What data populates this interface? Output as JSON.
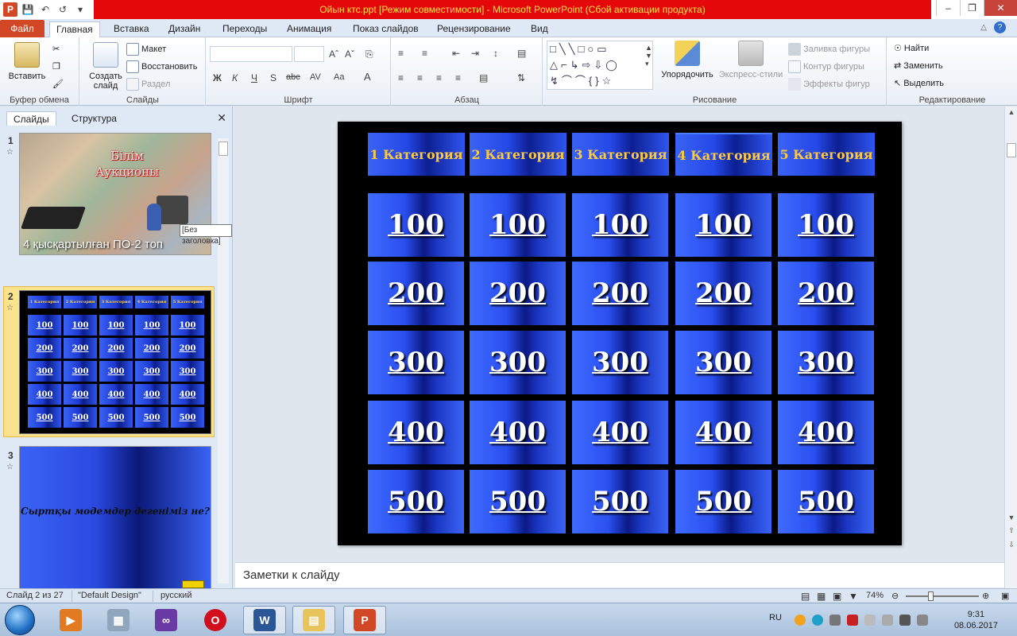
{
  "window": {
    "title": "Ойын ктс.ppt [Режим совместимости]  -  Microsoft PowerPoint (Сбой активации продукта)"
  },
  "tabs": {
    "file": "Файл",
    "items": [
      "Главная",
      "Вставка",
      "Дизайн",
      "Переходы",
      "Анимация",
      "Показ слайдов",
      "Рецензирование",
      "Вид"
    ]
  },
  "ribbon": {
    "clipboard": {
      "label": "Буфер обмена",
      "paste": "Вставить"
    },
    "slides": {
      "label": "Слайды",
      "new_slide": "Создать слайд",
      "layout": "Макет",
      "reset": "Восстановить",
      "section": "Раздел"
    },
    "font": {
      "label": "Шрифт"
    },
    "paragraph": {
      "label": "Абзац"
    },
    "drawing": {
      "label": "Рисование",
      "arrange": "Упорядочить",
      "quick_styles": "Экспресс-стили",
      "fill": "Заливка фигуры",
      "outline": "Контур фигуры",
      "effects": "Эффекты фигур"
    },
    "editing": {
      "label": "Редактирование",
      "find": "Найти",
      "replace": "Заменить",
      "select": "Выделить"
    }
  },
  "left_panel": {
    "tab_slides": "Слайды",
    "tab_outline": "Структура",
    "slide1": {
      "num": "1",
      "title_line1": "Білім",
      "title_line2": "Аукционы",
      "subtitle": "4 қысқартылған ПО-2 топ",
      "tooltip": "[Без заголовка]"
    },
    "slide2": {
      "num": "2"
    },
    "slide3": {
      "num": "3",
      "question": "Сыртқы модемдер дегеніміз не?"
    }
  },
  "slide": {
    "categories": [
      "1 Категория",
      "2 Категория",
      "3 Категория",
      "4 Категория",
      "5 Категория"
    ],
    "values": [
      "100",
      "200",
      "300",
      "400",
      "500"
    ]
  },
  "notes": {
    "placeholder": "Заметки к слайду"
  },
  "status": {
    "slide_counter": "Слайд 2 из 27",
    "theme": "\"Default Design\"",
    "language": "русский",
    "zoom": "74%"
  },
  "taskbar": {
    "lang": "RU",
    "time": "9:31",
    "date": "08.06.2017"
  },
  "colors": {
    "title_bar": "#e4080a",
    "title_text": "#ffe14a",
    "file_tab": "#d24726",
    "category_text": "#ffc93d",
    "cell_blue": "#2a4ff0"
  }
}
